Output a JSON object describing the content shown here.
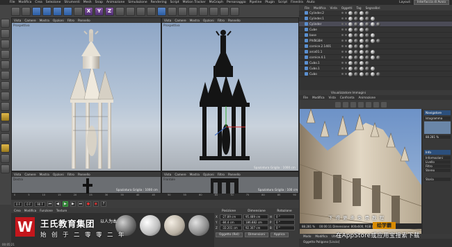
{
  "menubar": {
    "items": [
      "File",
      "Modifica",
      "Crea",
      "Selezione",
      "Strumenti",
      "Mesh",
      "Snap",
      "Animazione",
      "Simulazione",
      "Rendering",
      "Script",
      "Motion Tracker",
      "MoGraph",
      "Personaggio",
      "Pipeline",
      "Plugin",
      "Script",
      "Finestra",
      "Aiuto"
    ],
    "layout_label": "Layout:",
    "layout_value": "Interfaccia di Avvio"
  },
  "toolbar": {
    "xyz": [
      "X",
      "Y",
      "Z"
    ]
  },
  "viewport_left": {
    "menu": [
      "Vista",
      "Camere",
      "Mostra",
      "Opzioni",
      "Filtro",
      "Pannello"
    ],
    "label": "Prospettiva"
  },
  "viewport_right": {
    "menu": [
      "Vista",
      "Camere",
      "Mostra",
      "Opzioni",
      "Filtro",
      "Pannello"
    ],
    "label": "Prospettiva",
    "grid_label": "Spaziatura Griglia : 1000 cm"
  },
  "viewport_bl": {
    "menu": [
      "Vista",
      "Camere",
      "Mostra",
      "Opzioni",
      "Filtro",
      "Pannello"
    ],
    "label": "Destra",
    "grid_label": "Spaziatura Griglia : 1000 cm"
  },
  "viewport_br": {
    "menu": [
      "Vista",
      "Camere",
      "Mostra",
      "Opzioni",
      "Filtro",
      "Pannello"
    ],
    "label": "Frontale",
    "grid_label": "Spaziatura Griglia : 100 cm"
  },
  "timeline": {
    "ticks": [
      "0",
      "5",
      "10",
      "15",
      "20",
      "25",
      "30",
      "35",
      "40",
      "45",
      "50",
      "55",
      "60",
      "65",
      "70",
      "75",
      "80",
      "85",
      "90"
    ],
    "frame_end": "90 F",
    "current": "0 F",
    "start": "0 F"
  },
  "material": {
    "menu": [
      "Crea",
      "Modifica",
      "Funzione",
      "Texture"
    ],
    "spheres": [
      "#8a8a8a",
      "#cfcfcf",
      "#bdb8ae",
      "#9b9b9b"
    ]
  },
  "coords": {
    "headers": [
      "Posizione",
      "Dimensione",
      "Rotazione"
    ],
    "rows": [
      [
        "X",
        "-27.89 cm",
        "95.489 cm",
        "H",
        "0 °"
      ],
      [
        "Y",
        "-84.4 cm",
        "186.882 cm",
        "P",
        "0 °"
      ],
      [
        "Z",
        "-33.201 cm",
        "92.307 cm",
        "B",
        "0 °"
      ]
    ],
    "mode1": "Oggetto (Rel)",
    "mode2": "Dimensioni",
    "apply": "Applica"
  },
  "objects": {
    "tabs": [
      "File",
      "Modifica",
      "Vista",
      "Oggetti",
      "Tag",
      "Segnalibri"
    ],
    "rows": [
      {
        "name": "Cylinder.2"
      },
      {
        "name": "Cylinder.1"
      },
      {
        "name": "Cylinder"
      },
      {
        "name": "Cube"
      },
      {
        "name": "base"
      },
      {
        "name": "PIVBGBH"
      },
      {
        "name": "cornice.2.1401"
      },
      {
        "name": "arco01.1"
      },
      {
        "name": "cornice.4.1"
      },
      {
        "name": "Cubo.1"
      },
      {
        "name": "Cubo.1"
      },
      {
        "name": "Cubo"
      }
    ]
  },
  "picture_viewer": {
    "title": "Visualizzatore Immagini",
    "menu": [
      "File",
      "Modifica",
      "Vista",
      "Confronta",
      "Animazione"
    ],
    "zoom": "88.281 %",
    "status": "00:00:11  Dimensione: 800x600, RGB (8 Bit), 2.23 MB",
    "side_tabs": [
      "Navigatore",
      "Istogramma"
    ],
    "side_items": [
      "Info",
      "Informazioni",
      "Livello",
      "Filtro",
      "Stereo"
    ],
    "side_tab2": "Storia"
  },
  "attributes": {
    "tabs": [
      "Modo",
      "Modifica",
      "Utente"
    ],
    "title": "Oggetto Poligono [Liscio]"
  },
  "watermark": {
    "logo": "W",
    "brand": "王氏教育集团",
    "slogan": "以人为本",
    "motto": "始创于二零零二年",
    "right_line1": "下得更多免费教程",
    "badge": "绘学霸",
    "right_line2": "在AppStore或应用宝搜索下载"
  },
  "status": {
    "text": "00:05:21"
  }
}
